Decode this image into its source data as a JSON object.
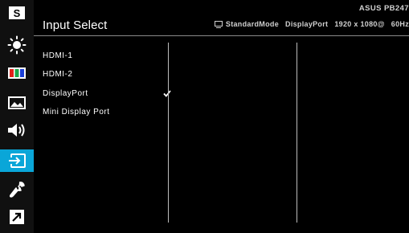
{
  "sidebar": {
    "items": [
      {
        "id": "splendid",
        "icon": "s-logo-icon",
        "label": "S"
      },
      {
        "id": "blue-light",
        "icon": "sun-icon"
      },
      {
        "id": "color",
        "icon": "color-bars-icon"
      },
      {
        "id": "image",
        "icon": "image-icon"
      },
      {
        "id": "sound",
        "icon": "speaker-icon"
      },
      {
        "id": "input-select",
        "icon": "input-select-icon",
        "active": true
      },
      {
        "id": "system-setup",
        "icon": "wrench-icon"
      },
      {
        "id": "shortcut",
        "icon": "shortcut-icon"
      }
    ],
    "accent": "#0aa6d8"
  },
  "header": {
    "title": "Input Select",
    "model": "ASUS PB247",
    "status": {
      "mode": "StandardMode",
      "input": "DisplayPort",
      "resolution": "1920 x 1080@",
      "refresh": "60Hz"
    }
  },
  "menu": {
    "items": [
      {
        "label": "HDMI-1",
        "selected": false
      },
      {
        "label": "HDMI-2",
        "selected": false
      },
      {
        "label": "DisplayPort",
        "selected": true
      },
      {
        "label": "Mini Display Port",
        "selected": false
      }
    ]
  }
}
